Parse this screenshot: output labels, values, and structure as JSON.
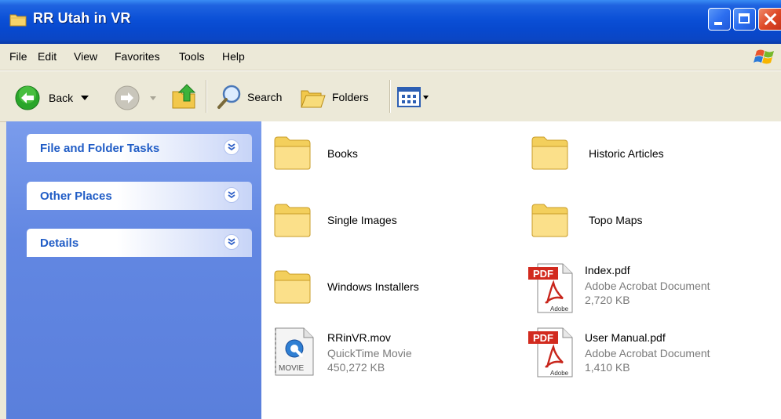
{
  "window": {
    "title": "RR Utah in VR"
  },
  "menu": [
    "File",
    "Edit",
    "View",
    "Favorites",
    "Tools",
    "Help"
  ],
  "toolbar": {
    "back": "Back",
    "search": "Search",
    "folders": "Folders"
  },
  "tasks": [
    {
      "label": "File and Folder Tasks"
    },
    {
      "label": "Other Places"
    },
    {
      "label": "Details"
    }
  ],
  "items": [
    {
      "name": "Books"
    },
    {
      "name": "Historic Articles"
    },
    {
      "name": "Single Images"
    },
    {
      "name": "Topo Maps"
    },
    {
      "name": "Windows Installers"
    },
    {
      "name": "Index.pdf",
      "type": "Adobe Acrobat Document",
      "size": "2,720 KB",
      "badge": "PDF",
      "brand": "Adobe"
    },
    {
      "name": "RRinVR.mov",
      "type": "QuickTime Movie",
      "size": "450,272 KB",
      "badge": "MOVIE"
    },
    {
      "name": "User Manual.pdf",
      "type": "Adobe Acrobat Document",
      "size": "1,410 KB",
      "badge": "PDF",
      "brand": "Adobe"
    }
  ]
}
